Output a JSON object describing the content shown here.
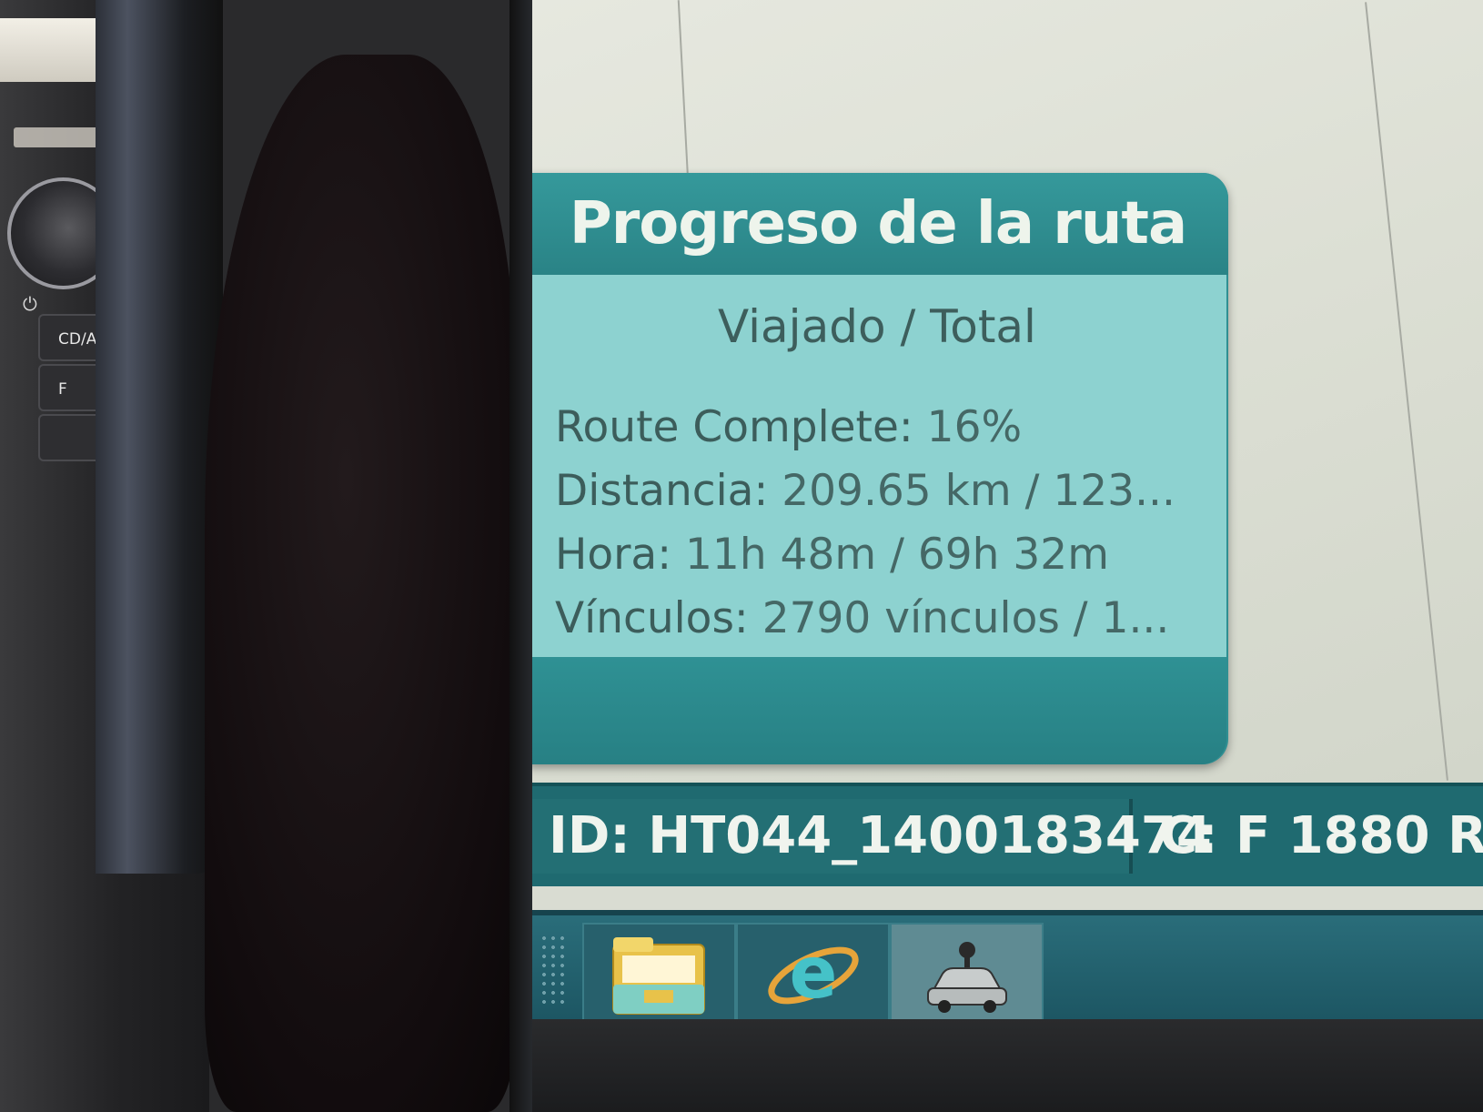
{
  "car_panel": {
    "buttons": [
      "CD/A",
      "F",
      ""
    ]
  },
  "route_progress": {
    "title": "Progreso de la ruta",
    "subtitle": "Viajado / Total",
    "route_complete": {
      "label": "Route Complete:",
      "value": "16%"
    },
    "distance": {
      "label": "Distancia:",
      "value": "209.65 km / 123..."
    },
    "time": {
      "label": "Hora:",
      "value": "11h 48m / 69h 32m"
    },
    "links": {
      "label": "Vínculos:",
      "value": "2790 vínculos / 1..."
    }
  },
  "status_bar": {
    "id_text": "ID: HT044_1400183474",
    "c_text": "C: F 1880 R"
  },
  "taskbar": {
    "items": [
      {
        "icon": "folder-icon"
      },
      {
        "icon": "internet-explorer-icon"
      },
      {
        "icon": "car-navigation-icon"
      }
    ]
  },
  "colors": {
    "popup_header": "#2f8f92",
    "popup_body": "#8dd2d0",
    "status_bar": "#1f6a70",
    "taskbar": "#1c5562"
  }
}
